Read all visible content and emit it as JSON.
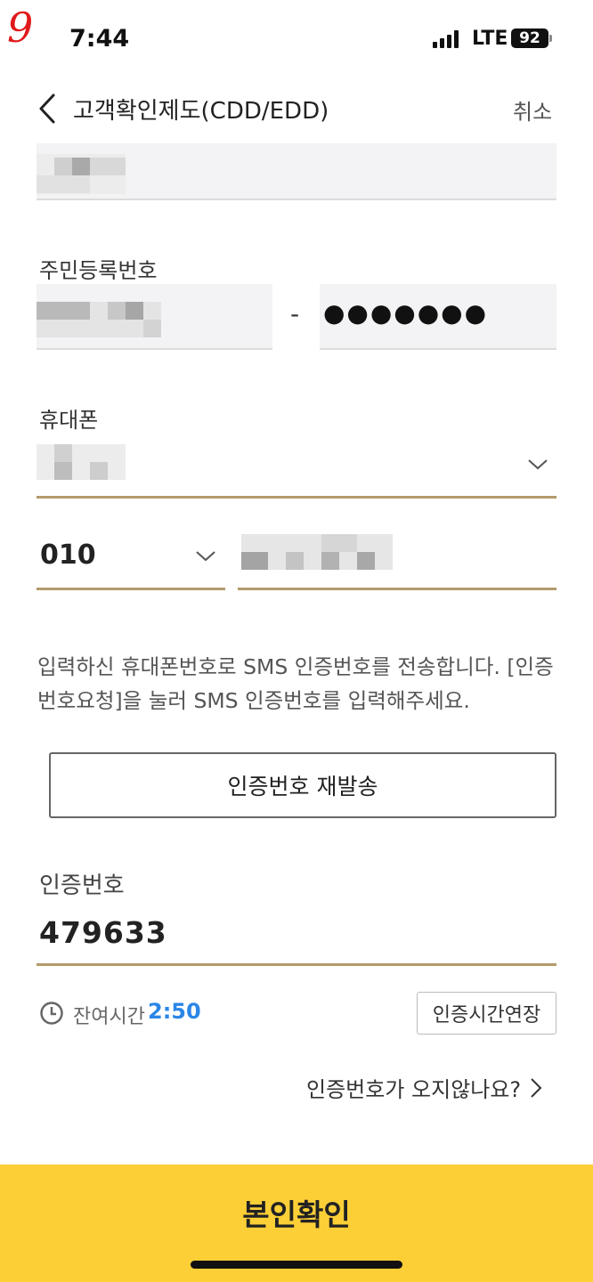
{
  "status_bar": {
    "annotation_mark": "9",
    "time": "7:44",
    "network": "LTE",
    "battery": "92"
  },
  "header": {
    "title": "고객확인제도(CDD/EDD)",
    "cancel_label": "취소"
  },
  "resident_number": {
    "label": "주민등록번호",
    "separator": "-",
    "masked_back": "●●●●●●●"
  },
  "phone": {
    "label": "휴대폰",
    "prefix": "010"
  },
  "notice": "입력하신 휴대폰번호로 SMS 인증번호를 전송합니다. [인증번호요청]을 눌러 SMS 인증번호를 입력해주세요.",
  "resend_button": "인증번호 재발송",
  "verification": {
    "label": "인증번호",
    "value": "479633"
  },
  "timer": {
    "label": "잔여시간",
    "value": "2:50",
    "extend_button": "인증시간연장"
  },
  "help_link": "인증번호가 오지않나요?",
  "confirm_button": "본인확인",
  "colors": {
    "accent_underline": "#b49a6c",
    "timer_blue": "#2b86e6",
    "confirm_yellow": "#fccf37"
  }
}
